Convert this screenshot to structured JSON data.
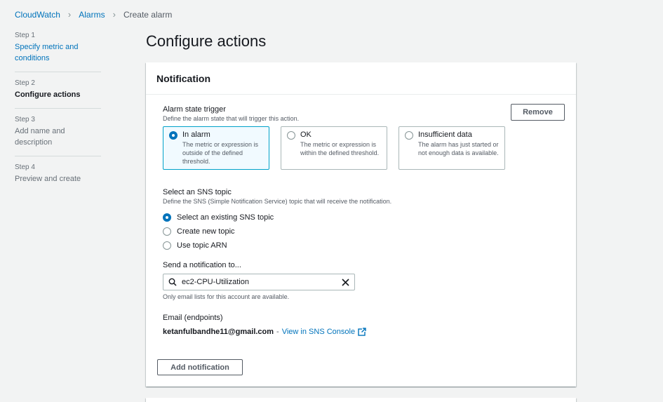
{
  "breadcrumb": {
    "items": [
      "CloudWatch",
      "Alarms",
      "Create alarm"
    ]
  },
  "steps": [
    {
      "num": "Step 1",
      "title": "Specify metric and conditions",
      "state": "link"
    },
    {
      "num": "Step 2",
      "title": "Configure actions",
      "state": "active"
    },
    {
      "num": "Step 3",
      "title": "Add name and description",
      "state": "disabled"
    },
    {
      "num": "Step 4",
      "title": "Preview and create",
      "state": "disabled"
    }
  ],
  "page": {
    "title": "Configure actions"
  },
  "notification": {
    "header": "Notification",
    "trigger_label": "Alarm state trigger",
    "trigger_desc": "Define the alarm state that will trigger this action.",
    "remove_label": "Remove",
    "tiles": [
      {
        "title": "In alarm",
        "desc": "The metric or expression is outside of the defined threshold.",
        "selected": true
      },
      {
        "title": "OK",
        "desc": "The metric or expression is within the defined threshold.",
        "selected": false
      },
      {
        "title": "Insufficient data",
        "desc": "The alarm has just started or not enough data is available.",
        "selected": false
      }
    ],
    "sns_label": "Select an SNS topic",
    "sns_desc": "Define the SNS (Simple Notification Service) topic that will receive the notification.",
    "sns_options": [
      {
        "label": "Select an existing SNS topic",
        "checked": true
      },
      {
        "label": "Create new topic",
        "checked": false
      },
      {
        "label": "Use topic ARN",
        "checked": false
      }
    ],
    "send_label": "Send a notification to...",
    "search_value": "ec2-CPU-Utilization",
    "search_hint": "Only email lists for this account are available.",
    "email_label": "Email (endpoints)",
    "email_address": "ketanfulbandhe11@gmail.com",
    "email_sep": "-",
    "sns_console_link": "View in SNS Console",
    "add_label": "Add notification"
  },
  "colors": {
    "link": "#0073bb",
    "selected_border": "#00a1c9",
    "selected_bg": "#f1faff",
    "background": "#f2f3f3"
  }
}
